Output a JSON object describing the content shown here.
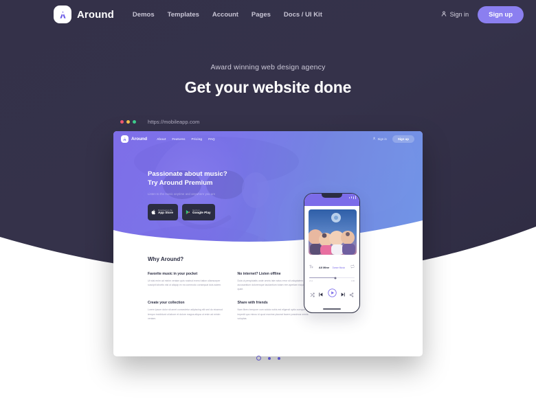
{
  "topnav": {
    "brand": "Around",
    "links": [
      "Demos",
      "Templates",
      "Account",
      "Pages",
      "Docs / UI Kit"
    ],
    "signin": "Sign in",
    "signup": "Sign up"
  },
  "hero": {
    "subtitle": "Award winning web design agency",
    "title": "Get your website done"
  },
  "browser": {
    "url": "https://mobileapp.com"
  },
  "mockup": {
    "nav": {
      "brand": "Around",
      "links": [
        "About",
        "Features",
        "Pricing",
        "FAQ"
      ],
      "signin": "Sign in",
      "signup": "Sign up"
    },
    "hero": {
      "line1": "Passionate about music?",
      "line2": "Try Around Premium",
      "subtitle": "Listen to the music anytime and anywhere you are",
      "store_buttons": [
        {
          "small": "Download on the",
          "large": "App Store",
          "icon": "apple-icon"
        },
        {
          "small": "Get it on",
          "large": "Google Play",
          "icon": "google-play-icon"
        }
      ]
    },
    "why": {
      "title": "Why Around?",
      "features": [
        {
          "heading": "Favorite music in your pocket",
          "body": "Ut wisi enim ad minim veniam quis nostrud exerci tation ullamcorper suscipit lobortis nisl ut aliquip ex ea commodo consequat duis autem."
        },
        {
          "heading": "No internet? Listen offline",
          "body": "Duis ut perspiciatis unde omnis iste natus error sit voluptatem accusantium doloremque laudantium totam rem aperiam eaque ipsa quae."
        },
        {
          "heading": "Create your collection",
          "body": "Lorem ipsum dolor sit amet consectetur adipiscing elit sed do eiusmod tempor incididunt ut labore et dolore magna aliqua ut enim ad minim veniam."
        },
        {
          "heading": "Share with friends",
          "body": "Nam libero tempore cum soluta nobis est eligendi optio cumque nihil impedit quo minus id quod maxime placeat facere possimus omnis voluptas."
        }
      ]
    },
    "phone": {
      "track_name": "All Mine",
      "track_artist": "Dance Music",
      "time_elapsed": "2:14",
      "time_total": "3:45",
      "controls": [
        "shuffle-icon",
        "previous-icon",
        "play-icon",
        "next-icon",
        "share-icon"
      ]
    }
  },
  "carousel": {
    "slides": 3,
    "active": 1
  },
  "colors": {
    "dark_bg": "#343149",
    "accent": "#8b7ff0",
    "accent_deep": "#5d56c4",
    "gradient_start": "#7b6ae8",
    "gradient_end": "#6f96e8",
    "ink": "#2b2d42"
  }
}
